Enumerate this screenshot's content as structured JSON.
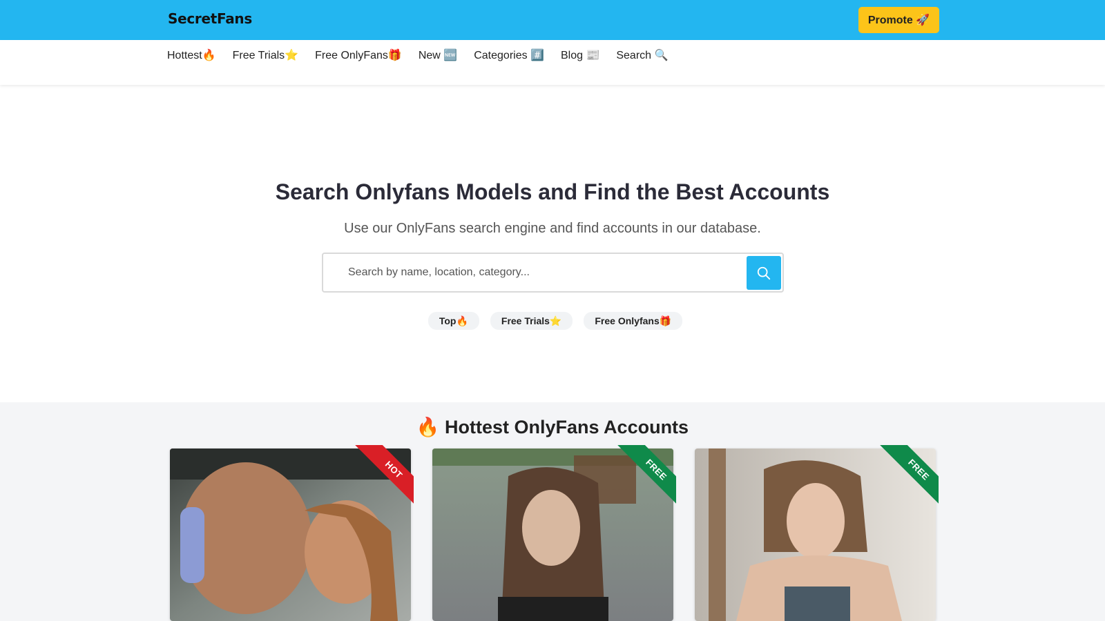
{
  "header": {
    "logo": "SecretFans",
    "promote_label": "Promote 🚀",
    "brand_color": "#23b6f0",
    "promote_color": "#fcc419"
  },
  "nav": {
    "items": [
      {
        "label": "Hottest🔥"
      },
      {
        "label": "Free Trials⭐"
      },
      {
        "label": "Free OnlyFans🎁"
      },
      {
        "label": "New 🆕"
      },
      {
        "label": "Categories #️⃣"
      },
      {
        "label": "Blog 📰"
      },
      {
        "label": "Search 🔍"
      }
    ]
  },
  "hero": {
    "title": "Search Onlyfans Models and Find the Best Accounts",
    "subtitle": "Use our OnlyFans search engine and find accounts in our database.",
    "search_placeholder": "Search by name, location, category...",
    "search_value": "",
    "search_icon": "search-icon",
    "pills": [
      {
        "label": "Top🔥"
      },
      {
        "label": "Free Trials⭐"
      },
      {
        "label": "Free Onlyfans🎁"
      }
    ]
  },
  "section": {
    "title": "🔥 Hottest OnlyFans Accounts",
    "cards": [
      {
        "ribbon": "HOT",
        "ribbon_color": "#d91f26"
      },
      {
        "ribbon": "FREE",
        "ribbon_color": "#0f8a4a"
      },
      {
        "ribbon": "FREE",
        "ribbon_color": "#0f8a4a"
      }
    ]
  }
}
